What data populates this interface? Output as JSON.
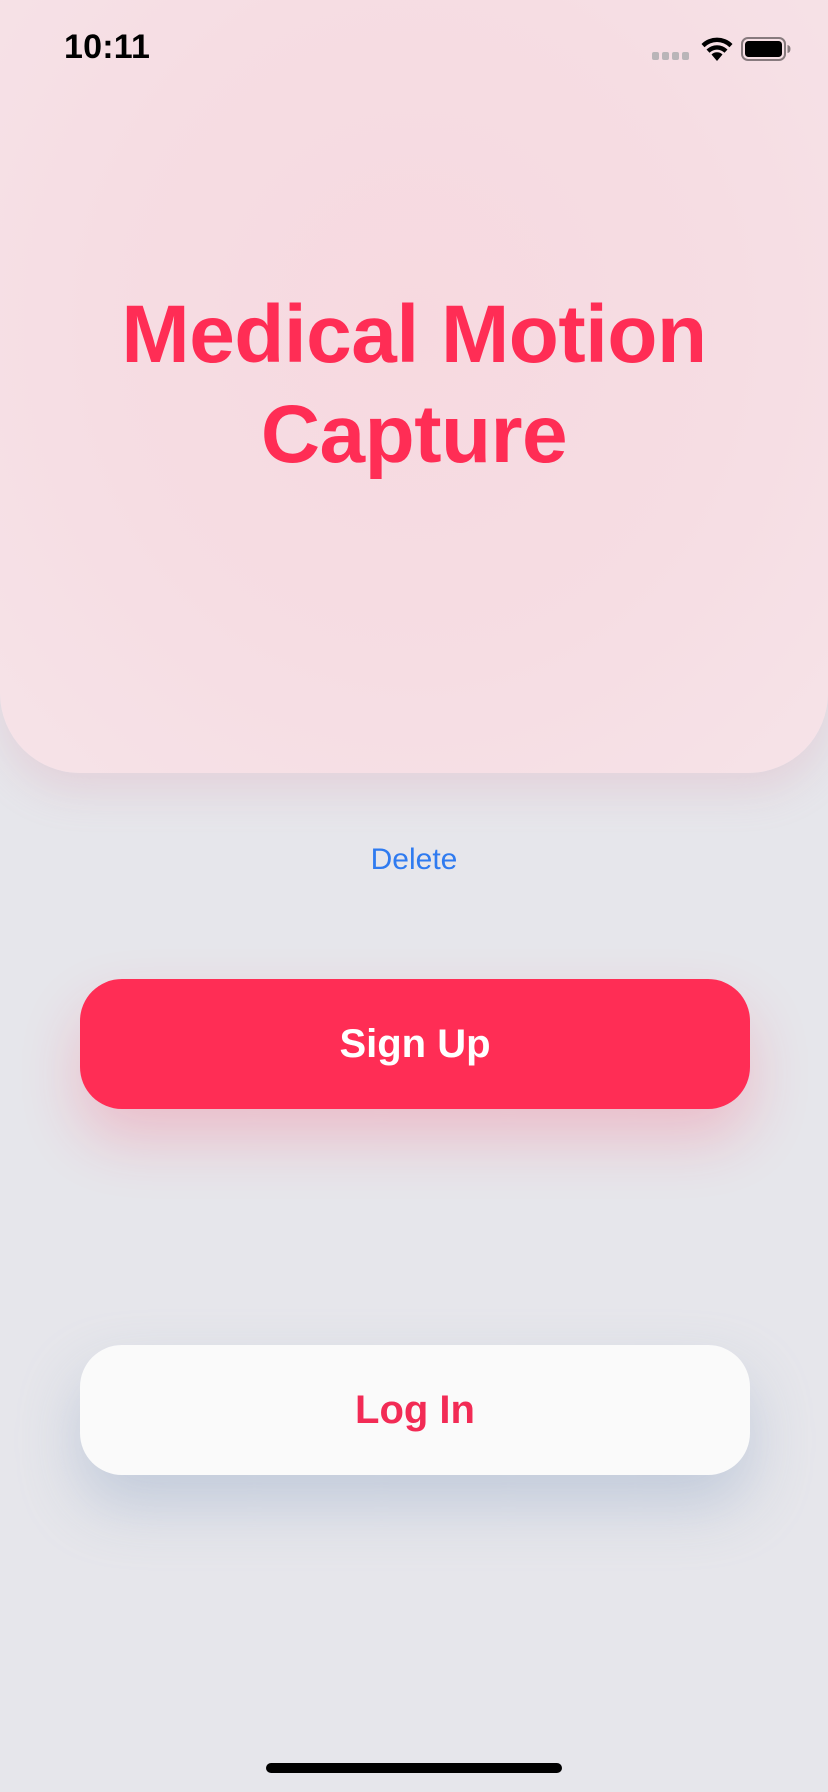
{
  "status_bar": {
    "time": "10:11",
    "icons": [
      "signal-icon",
      "wifi-icon",
      "battery-icon"
    ]
  },
  "hero": {
    "title_line1": "Medical Motion",
    "title_line2": "Capture"
  },
  "actions": {
    "delete_label": "Delete",
    "signup_label": "Sign Up",
    "login_label": "Log In"
  },
  "colors": {
    "accent": "#ff2d55",
    "link": "#2f7bf0",
    "background": "#e6e6eb",
    "hero_background": "#f6dde3",
    "login_button_background": "#fafafa"
  }
}
